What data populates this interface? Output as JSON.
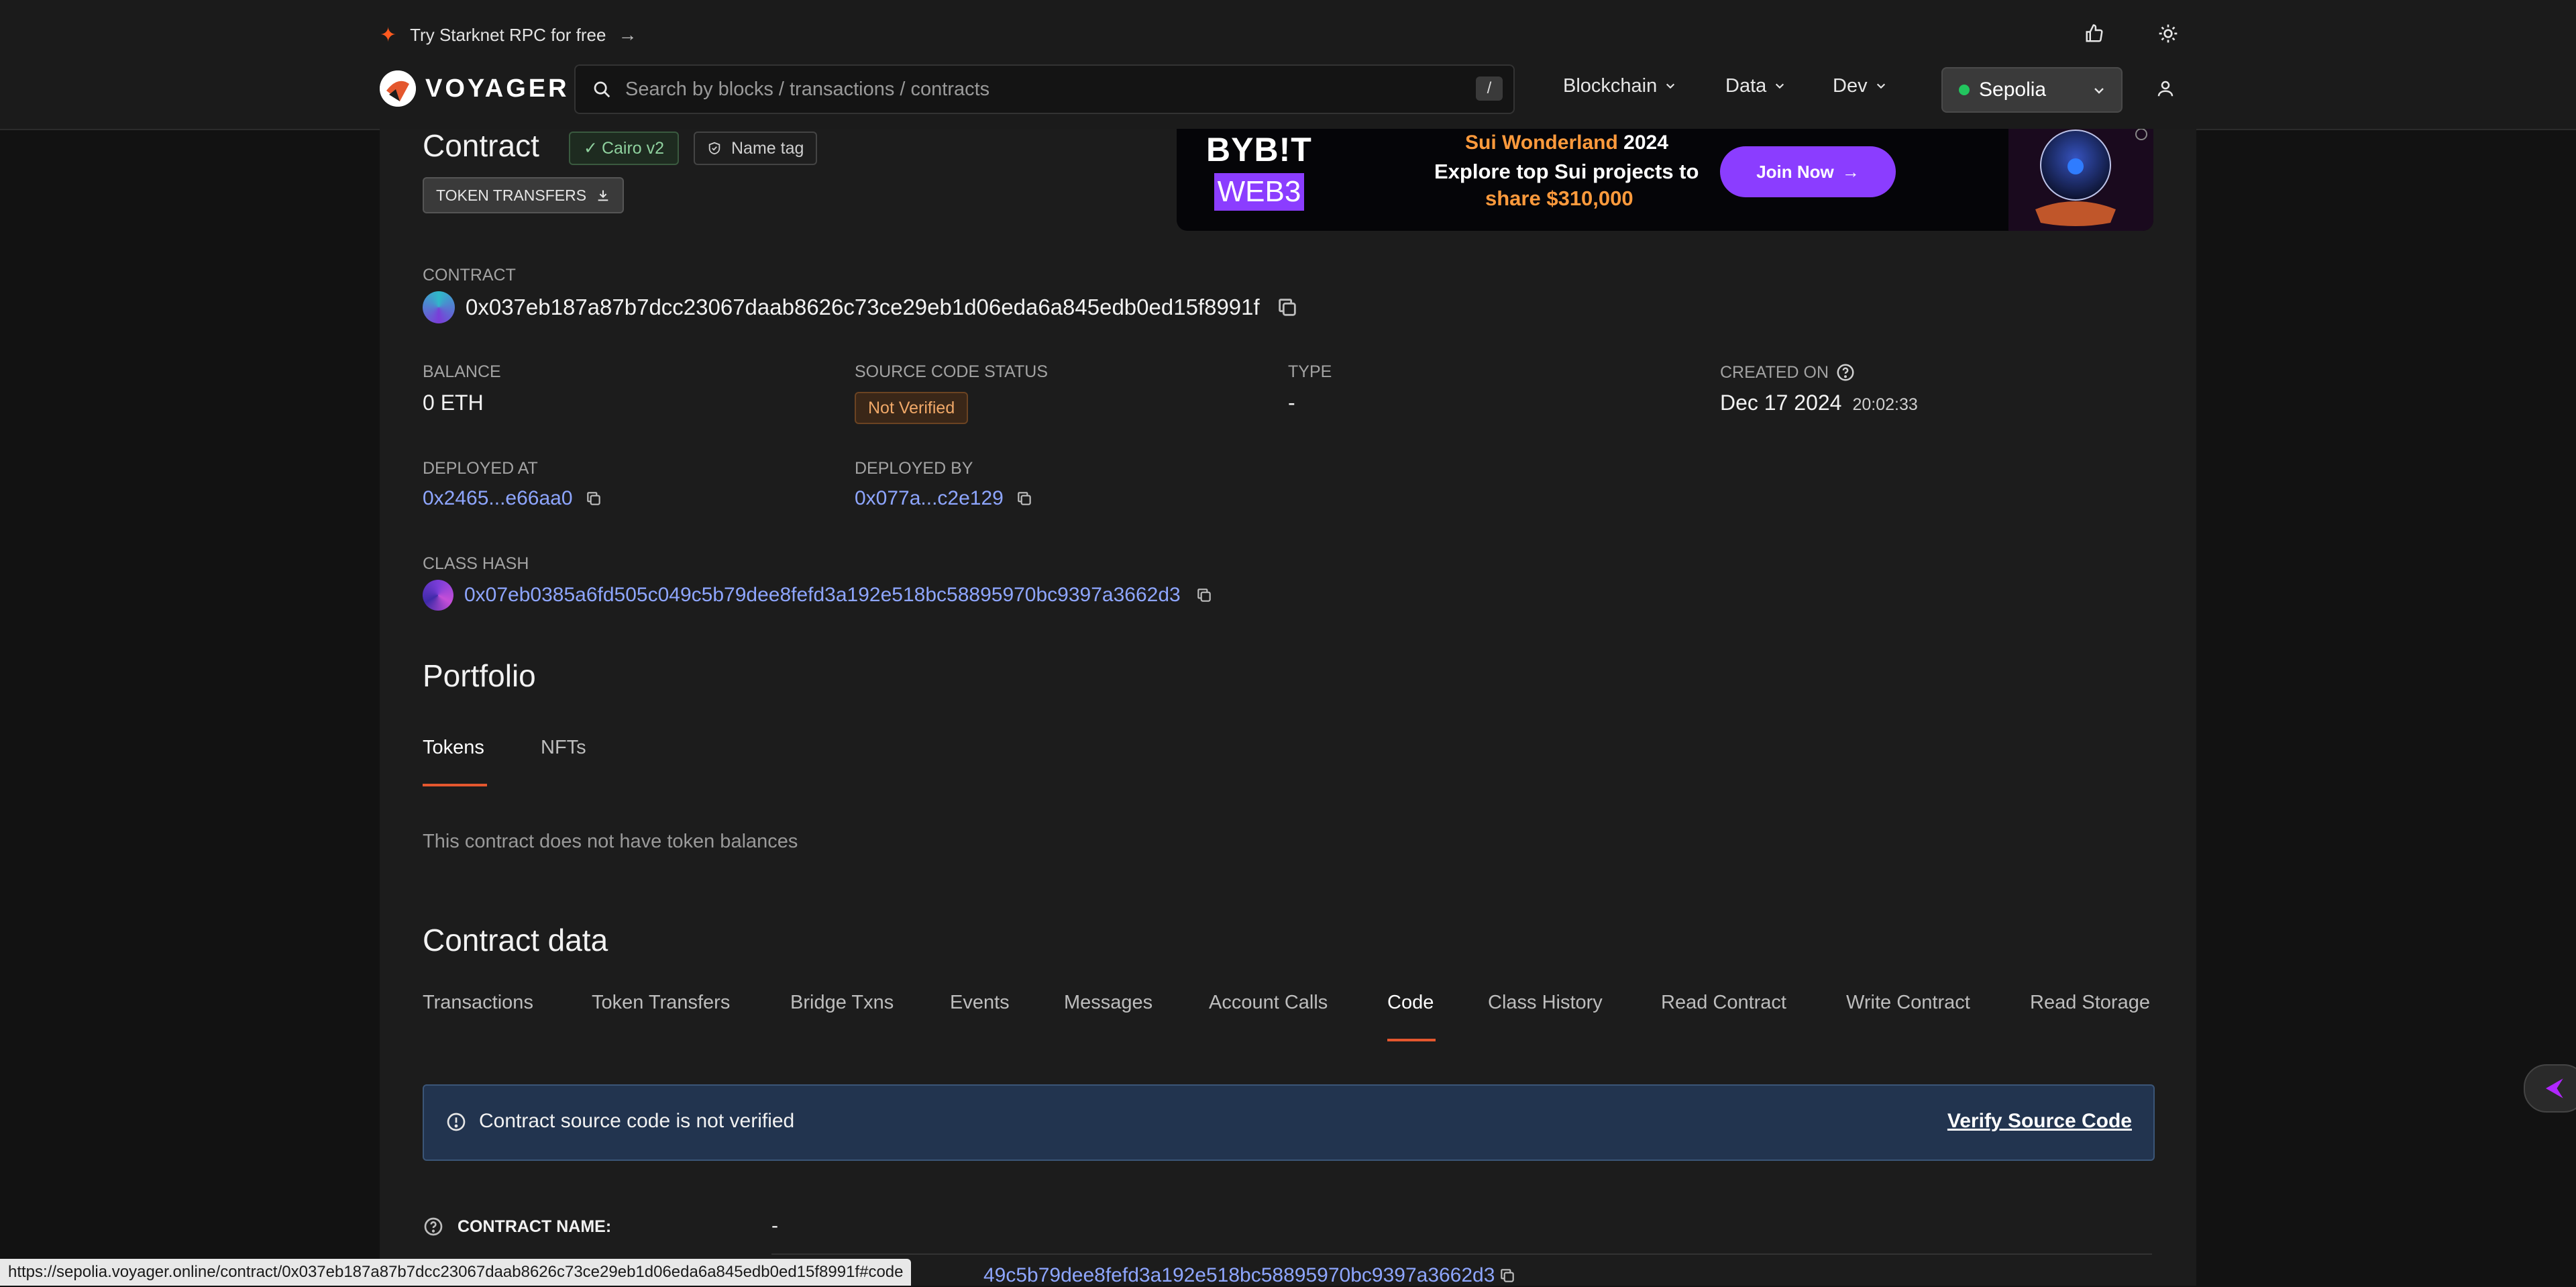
{
  "header": {
    "promo_text": "Try Starknet RPC for free",
    "logo_text": "VOYAGER",
    "search_placeholder": "Search by blocks / transactions / contracts",
    "search_shortcut": "/",
    "nav": [
      "Blockchain",
      "Data",
      "Dev"
    ],
    "network": "Sepolia"
  },
  "ad": {
    "brand_top": "BYB!T",
    "brand_bottom": "WEB3",
    "line1_accent": "Sui Wonderland",
    "line1_year": "2024",
    "line2": "Explore top Sui projects to",
    "line3": "share $310,000",
    "cta": "Join Now"
  },
  "contract": {
    "heading": "Contract",
    "badge_cairo": "Cairo v2",
    "badge_name": "Name tag",
    "token_transfers_btn": "TOKEN TRANSFERS",
    "label": "CONTRACT",
    "address": "0x037eb187a87b7dcc23067daab8626c73ce29eb1d06eda6a845edb0ed15f8991f",
    "balance_label": "BALANCE",
    "balance": "0 ETH",
    "source_label": "SOURCE CODE STATUS",
    "source_status": "Not Verified",
    "type_label": "TYPE",
    "type": "-",
    "created_label": "CREATED ON",
    "created_date": "Dec 17 2024",
    "created_time": "20:02:33",
    "deployed_at_label": "DEPLOYED AT",
    "deployed_at": "0x2465...e66aa0",
    "deployed_by_label": "DEPLOYED BY",
    "deployed_by": "0x077a...c2e129",
    "class_hash_label": "CLASS HASH",
    "class_hash": "0x07eb0385a6fd505c049c5b79dee8fefd3a192e518bc58895970bc9397a3662d3"
  },
  "portfolio": {
    "heading": "Portfolio",
    "tabs": [
      "Tokens",
      "NFTs"
    ],
    "empty": "This contract does not have token balances"
  },
  "contract_data": {
    "heading": "Contract data",
    "tabs": [
      "Transactions",
      "Token Transfers",
      "Bridge Txns",
      "Events",
      "Messages",
      "Account Calls",
      "Code",
      "Class History",
      "Read Contract",
      "Write Contract",
      "Read Storage"
    ],
    "alert": "Contract source code is not verified",
    "alert_action": "Verify Source Code",
    "name_label": "CONTRACT NAME:",
    "name_value": "-",
    "partial_hash": "49c5b79dee8fefd3a192e518bc58895970bc9397a3662d3"
  },
  "statusbar_url": "https://sepolia.voyager.online/contract/0x037eb187a87b7dcc23067daab8626c73ce29eb1d06eda6a845edb0ed15f8991f#code",
  "colors": {
    "accent": "#e4572e",
    "link": "#8ea6ff",
    "network_dot": "#22c55e"
  }
}
